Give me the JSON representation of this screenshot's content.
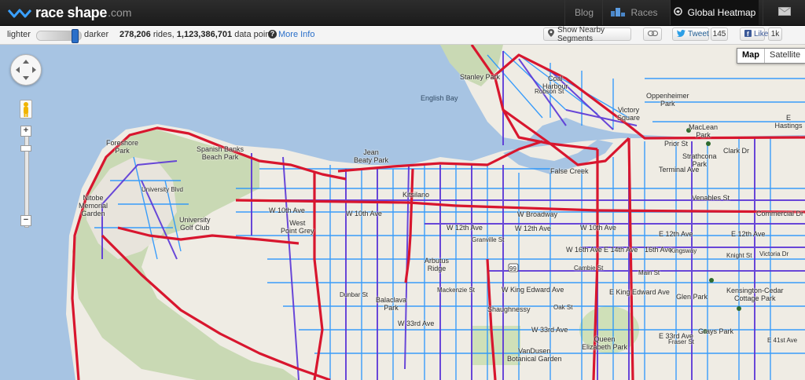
{
  "header": {
    "logo_name": "race",
    "logo_name2": "shape",
    "logo_domain": ".com",
    "nav": {
      "blog": "Blog",
      "races": "Races",
      "heatmap": "Global Heatmap"
    },
    "icons": {
      "races": "podium-icon",
      "heatmap": "globe-icon",
      "mail": "envelope-icon"
    }
  },
  "toolbar": {
    "lighter_label": "lighter",
    "darker_label": "darker",
    "intensity": 0.92,
    "rides_count": "278,206",
    "rides_suffix": " rides, ",
    "points_count": "1,123,386,701",
    "points_suffix": " data points",
    "more_info": "More Info",
    "nearby_segments": "Show Nearby Segments",
    "tweet_label": "Tweet",
    "tweet_count": "145",
    "like_label": "Like",
    "like_count": "1k",
    "accent_color": "#2a6fc9"
  },
  "map": {
    "type_buttons": {
      "map": "Map",
      "satellite": "Satellite"
    },
    "selected_type": "Map",
    "zoom_in": "+",
    "zoom_out": "−",
    "heat_colors": {
      "strong": "#d8162e",
      "medium": "#6b2bbf",
      "light": "#1a8fff"
    },
    "labels": {
      "stanley_park": "Stanley Park",
      "english_bay": "English Bay",
      "coal_harbour": "Coal\nHarbour",
      "robson": "Robson St",
      "victory_square": "Victory\nSquare",
      "oppenheimer": "Oppenheimer\nPark",
      "maclean": "MacLean\nPark",
      "prior_st": "Prior St",
      "strathcona": "Strathcona\nPark",
      "terminal_ave": "Terminal Ave",
      "e_hastings": "E Hastings",
      "venables": "Venables St",
      "clark_dr": "Clark Dr",
      "commercial": "Commercial Dr",
      "foreshore": "Foreshore\nPark",
      "spanish_banks": "Spanish Banks\nBeach Park",
      "jean_beaty": "Jean\nBeaty Park",
      "nitobe": "Nitobe\nMemorial\nGarden",
      "university_blvd": "University Blvd",
      "ubc_golf": "University\nGolf Club",
      "w_10th_a": "W 10th Ave",
      "w_10th_b": "W 10th Ave",
      "w_10th_c": "W 10th Ave",
      "west_point_grey": "West\nPoint Grey",
      "kitsilano": "Kitsilano",
      "false_creek": "False Creek",
      "w_broadway": "W Broadway",
      "w_12th": "W 12th Ave",
      "w_12th_b": "W 12th Ave",
      "granville_a": "Granville St",
      "arbutus_ridge": "Arbutus\nRidge",
      "w_16th": "W 16th Ave",
      "e_12th": "E 12th Ave",
      "e_12th_b": "E 12th Ave",
      "e_14th": "E 14th Ave",
      "e_16th": "16th Ave",
      "kingsway": "Kingsway",
      "w_king_edward": "W King Edward Ave",
      "e_king_edward": "E King Edward Ave",
      "glen_park": "Glen Park",
      "kensington": "Kensington-Cedar\nCottage Park",
      "shaughnessy": "Shaughnessy",
      "balaclava": "Balaclava\nPark",
      "w_33rd": "W 33rd Ave",
      "w_33rd_b": "W 33rd Ave",
      "e_33rd": "E 33rd Ave",
      "queen_elizabeth": "Queen\nElizabeth Park",
      "grays_park": "Grays Park",
      "vandusen": "VanDusen\nBotanical Garden",
      "dunbar": "Dunbar St",
      "mackenzie": "Mackenzie St",
      "oak_st": "Oak St",
      "cambie": "Cambie St",
      "main_st": "Main St",
      "fraser": "Fraser St",
      "knight": "Knight St",
      "victoria": "Victoria Dr",
      "hwy99": "99",
      "e_41st": "E 41st Ave"
    }
  }
}
